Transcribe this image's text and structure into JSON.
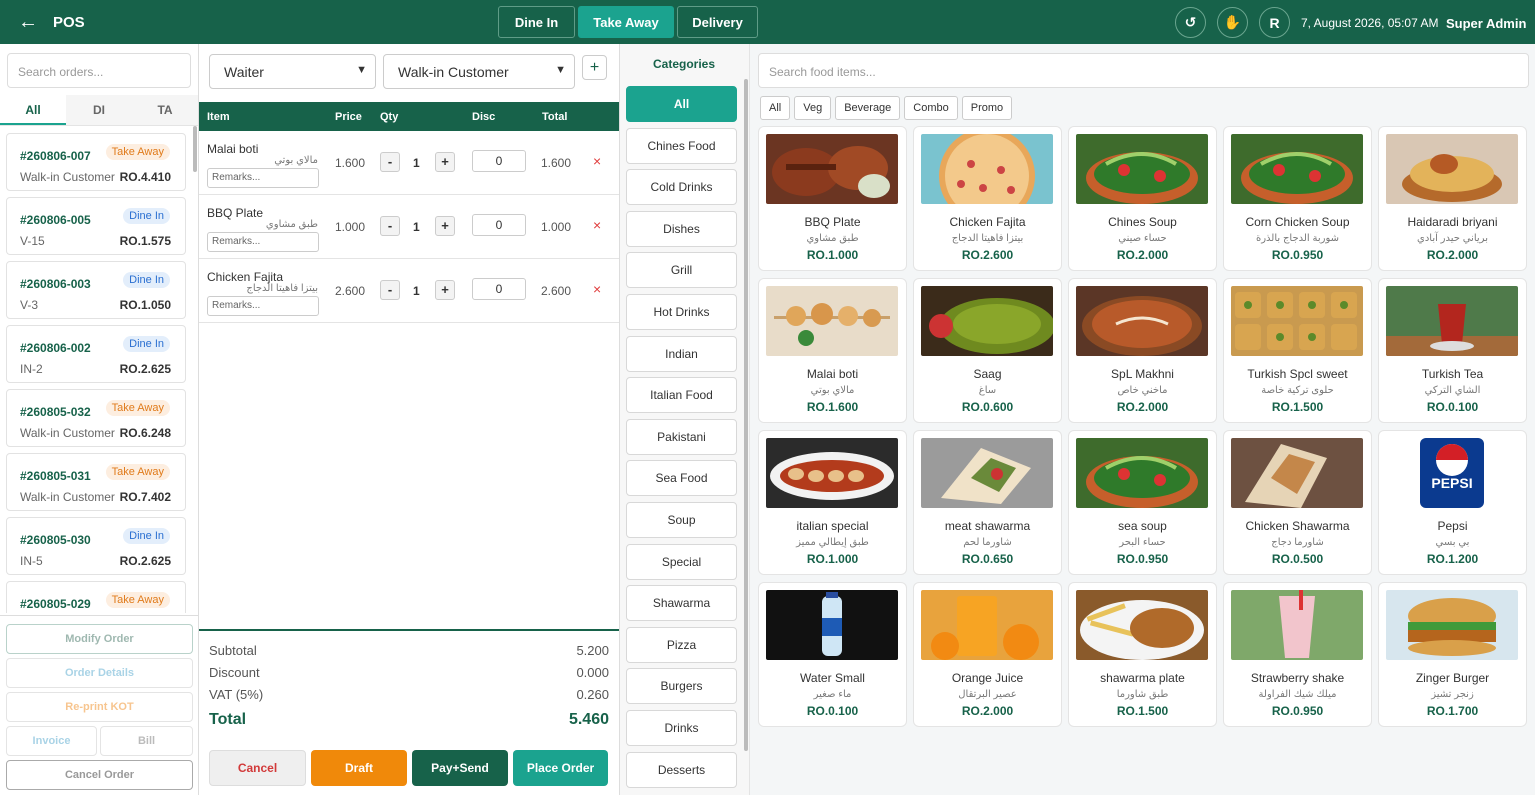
{
  "app": {
    "title": "POS",
    "back_icon": "←"
  },
  "order_types": [
    {
      "label": "Dine In"
    },
    {
      "label": "Take Away"
    },
    {
      "label": "Delivery"
    }
  ],
  "topbar": {
    "refresh_icon": "↺",
    "hand_icon": "✋",
    "user_initial": "R",
    "datetime": "7, August 2026, 05:07 AM",
    "user": "Super Admin"
  },
  "orders_panel": {
    "search_placeholder": "Search orders...",
    "tabs": [
      "All",
      "DI",
      "TA"
    ],
    "orders": [
      {
        "number": "#260806-007",
        "badge": "Take Away",
        "customer": "Walk-in Customer",
        "amount": "RO.4.410"
      },
      {
        "number": "#260806-005",
        "badge": "Dine In",
        "customer": "V-15",
        "amount": "RO.1.575"
      },
      {
        "number": "#260806-003",
        "badge": "Dine In",
        "customer": "V-3",
        "amount": "RO.1.050"
      },
      {
        "number": "#260806-002",
        "badge": "Dine In",
        "customer": "IN-2",
        "amount": "RO.2.625"
      },
      {
        "number": "#260805-032",
        "badge": "Take Away",
        "customer": "Walk-in Customer",
        "amount": "RO.6.248"
      },
      {
        "number": "#260805-031",
        "badge": "Take Away",
        "customer": "Walk-in Customer",
        "amount": "RO.7.402"
      },
      {
        "number": "#260805-030",
        "badge": "Dine In",
        "customer": "IN-5",
        "amount": "RO.2.625"
      },
      {
        "number": "#260805-029",
        "badge": "Take Away",
        "customer": "",
        "amount": ""
      }
    ],
    "actions": {
      "modify": "Modify Order",
      "details": "Order Details",
      "reprint": "Re-print KOT",
      "invoice": "Invoice",
      "bill": "Bill",
      "cancel": "Cancel Order"
    }
  },
  "cart": {
    "waiter": "Waiter",
    "customer": "Walk-in Customer",
    "add_icon": "+",
    "headers": {
      "item": "Item",
      "price": "Price",
      "qty": "Qty",
      "disc": "Disc",
      "total": "Total"
    },
    "items": [
      {
        "name": "Malai boti",
        "arabic": "مالاي بوتي",
        "remarks_placeholder": "Remarks...",
        "price": "1.600",
        "qty": "1",
        "disc": "0",
        "total": "1.600"
      },
      {
        "name": "BBQ Plate",
        "arabic": "طبق مشاوي",
        "remarks_placeholder": "Remarks...",
        "price": "1.000",
        "qty": "1",
        "disc": "0",
        "total": "1.000"
      },
      {
        "name": "Chicken Fajita",
        "arabic": "بيتزا فاهيتا الدجاج",
        "remarks_placeholder": "Remarks...",
        "price": "2.600",
        "qty": "1",
        "disc": "0",
        "total": "2.600"
      }
    ],
    "minus": "-",
    "plus": "+",
    "remove_icon": "×",
    "summary": {
      "subtotal_label": "Subtotal",
      "subtotal": "5.200",
      "discount_label": "Discount",
      "discount": "0.000",
      "vat_label": "VAT (5%)",
      "vat": "0.260",
      "total_label": "Total",
      "total": "5.460"
    },
    "buttons": {
      "cancel": "Cancel",
      "draft": "Draft",
      "pay_send": "Pay+Send",
      "place": "Place Order"
    }
  },
  "categories": {
    "title": "Categories",
    "items": [
      "All",
      "Chines Food",
      "Cold Drinks",
      "Dishes",
      "Grill",
      "Hot Drinks",
      "Indian",
      "Italian Food",
      "Pakistani",
      "Sea Food",
      "Soup",
      "Special",
      "Shawarma",
      "Pizza",
      "Burgers",
      "Drinks",
      "Desserts"
    ]
  },
  "menu": {
    "search_placeholder": "Search food items...",
    "filters": [
      "All",
      "Veg",
      "Beverage",
      "Combo",
      "Promo"
    ],
    "items": [
      {
        "name": "BBQ Plate",
        "arabic": "طبق مشاوي",
        "price": "RO.1.000",
        "img": "bbq"
      },
      {
        "name": "Chicken Fajita",
        "arabic": "بيتزا فاهيتا الدجاج",
        "price": "RO.2.600",
        "img": "pizza"
      },
      {
        "name": "Chines Soup",
        "arabic": "حساء صيني",
        "price": "RO.2.000",
        "img": "noodles"
      },
      {
        "name": "Corn Chicken Soup",
        "arabic": "شوربة الدجاج بالذرة",
        "price": "RO.0.950",
        "img": "noodles"
      },
      {
        "name": "Haidaradi briyani",
        "arabic": "برياني حيدر آبادي",
        "price": "RO.2.000",
        "img": "biryani"
      },
      {
        "name": "Malai boti",
        "arabic": "مالاي بوتي",
        "price": "RO.1.600",
        "img": "skewers"
      },
      {
        "name": "Saag",
        "arabic": "ساغ",
        "price": "RO.0.600",
        "img": "saag"
      },
      {
        "name": "SpL Makhni",
        "arabic": "ماخني خاص",
        "price": "RO.2.000",
        "img": "makhni"
      },
      {
        "name": "Turkish Spcl sweet",
        "arabic": "حلوى تركية خاصة",
        "price": "RO.1.500",
        "img": "sweet"
      },
      {
        "name": "Turkish Tea",
        "arabic": "الشاي التركي",
        "price": "RO.0.100",
        "img": "tea"
      },
      {
        "name": "italian special",
        "arabic": "طبق إيطالي مميز",
        "price": "RO.1.000",
        "img": "italian"
      },
      {
        "name": "meat shawarma",
        "arabic": "شاورما لحم",
        "price": "RO.0.650",
        "img": "wrap"
      },
      {
        "name": "sea soup",
        "arabic": "حساء البحر",
        "price": "RO.0.950",
        "img": "noodles"
      },
      {
        "name": "Chicken Shawarma",
        "arabic": "شاورما دجاج",
        "price": "RO.0.500",
        "img": "wrap2"
      },
      {
        "name": "Pepsi",
        "arabic": "بي بسي",
        "price": "RO.1.200",
        "img": "pepsi"
      },
      {
        "name": "Water Small",
        "arabic": "ماء صغير",
        "price": "RO.0.100",
        "img": "water"
      },
      {
        "name": "Orange Juice",
        "arabic": "عصير البرتقال",
        "price": "RO.2.000",
        "img": "juice"
      },
      {
        "name": "shawarma plate",
        "arabic": "طبق شاورما",
        "price": "RO.1.500",
        "img": "plate"
      },
      {
        "name": "Strawberry shake",
        "arabic": "ميلك شيك الفراولة",
        "price": "RO.0.950",
        "img": "shake"
      },
      {
        "name": "Zinger Burger",
        "arabic": "زنجر تشيز",
        "price": "RO.1.700",
        "img": "burger"
      }
    ],
    "pepsi_logo_text": "PEPSI"
  },
  "colors": {
    "primary": "#17624a",
    "accent": "#1ba38f",
    "orange": "#f0890a",
    "danger": "#e03c3c"
  }
}
